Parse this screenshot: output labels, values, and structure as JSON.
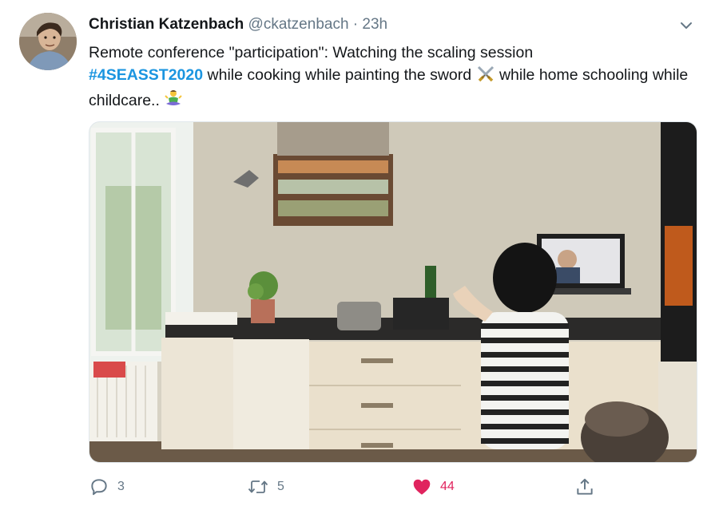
{
  "tweet": {
    "author_name": "Christian Katzenbach",
    "author_handle": "@ckatzenbach",
    "separator": "·",
    "timestamp": "23h",
    "text_part1": "Remote conference \"participation\": Watching  the scaling session",
    "hashtag": "#4SEASST2020",
    "text_part2": " while cooking while painting the sword ",
    "text_part3": " while home schooling while childcare.. ",
    "emoji_1": "crossed-swords",
    "emoji_2": "person-in-lotus-position"
  },
  "media": {
    "description_icon": "photo"
  },
  "actions": {
    "reply_count": "3",
    "retweet_count": "5",
    "like_count": "44",
    "like_color": "#e0245e",
    "icon_color": "#657786"
  },
  "colors": {
    "link": "#1b95e0",
    "text": "#14171a",
    "muted": "#657786"
  }
}
